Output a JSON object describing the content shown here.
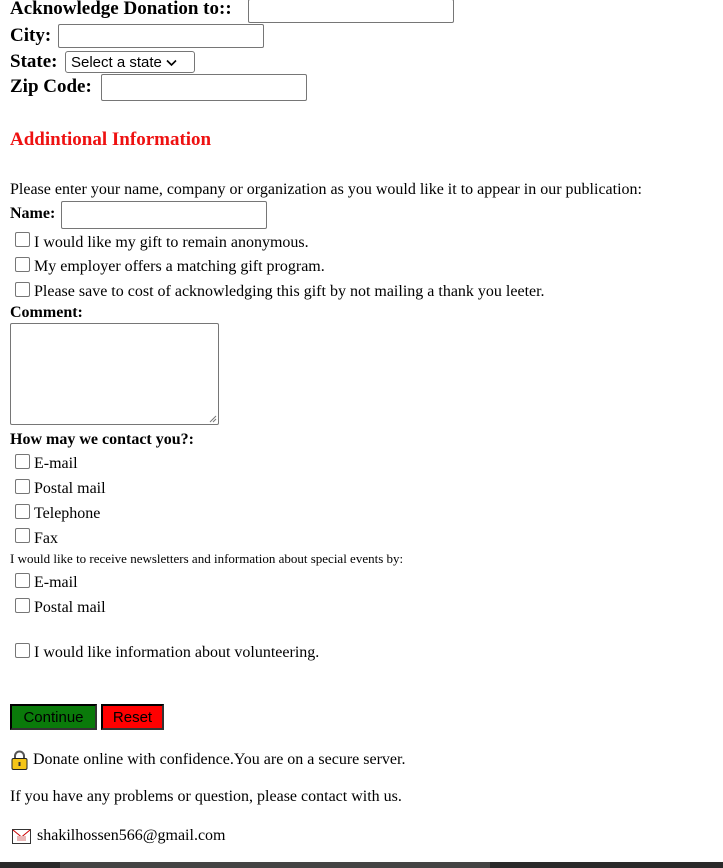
{
  "address": {
    "acknowledge_label": "Acknowledge Donation to::",
    "acknowledge_value": "",
    "city_label": "City:",
    "city_value": "",
    "state_label": "State:",
    "state_selected": "Select a state",
    "zip_label": "Zip Code:",
    "zip_value": ""
  },
  "additional": {
    "heading": "Addintional Information",
    "publication_prompt": "Please enter your name, company or organization as you would like it to appear in our publication:",
    "name_label": "Name:",
    "name_value": "",
    "options": [
      "I would like my gift to remain anonymous.",
      "My employer offers a matching gift program.",
      "Please save to cost of acknowledging this gift by not mailing a thank you leeter."
    ],
    "comment_label": "Comment:",
    "comment_value": ""
  },
  "contact": {
    "question": "How may we contact you?:",
    "methods": [
      "E-mail",
      "Postal mail",
      "Telephone",
      "Fax"
    ],
    "newsletter_prompt": "I would like to receive newsletters and information about special events by:",
    "newsletter_methods": [
      "E-mail",
      "Postal mail"
    ],
    "volunteer": "I would like information about volunteering."
  },
  "actions": {
    "continue_label": "Continue",
    "reset_label": "Reset",
    "continue_color": "#0a7a0a",
    "reset_color": "#ff0000"
  },
  "footer": {
    "secure_icon": "lock-icon",
    "secure_text": "Donate online with confidence.You are on a secure server.",
    "help_text": "If you have any problems or question, please contact with us.",
    "email_icon": "envelope-icon",
    "email": "shakilhossen566@gmail.com"
  },
  "colors": {
    "heading_red": "#ee1111"
  }
}
